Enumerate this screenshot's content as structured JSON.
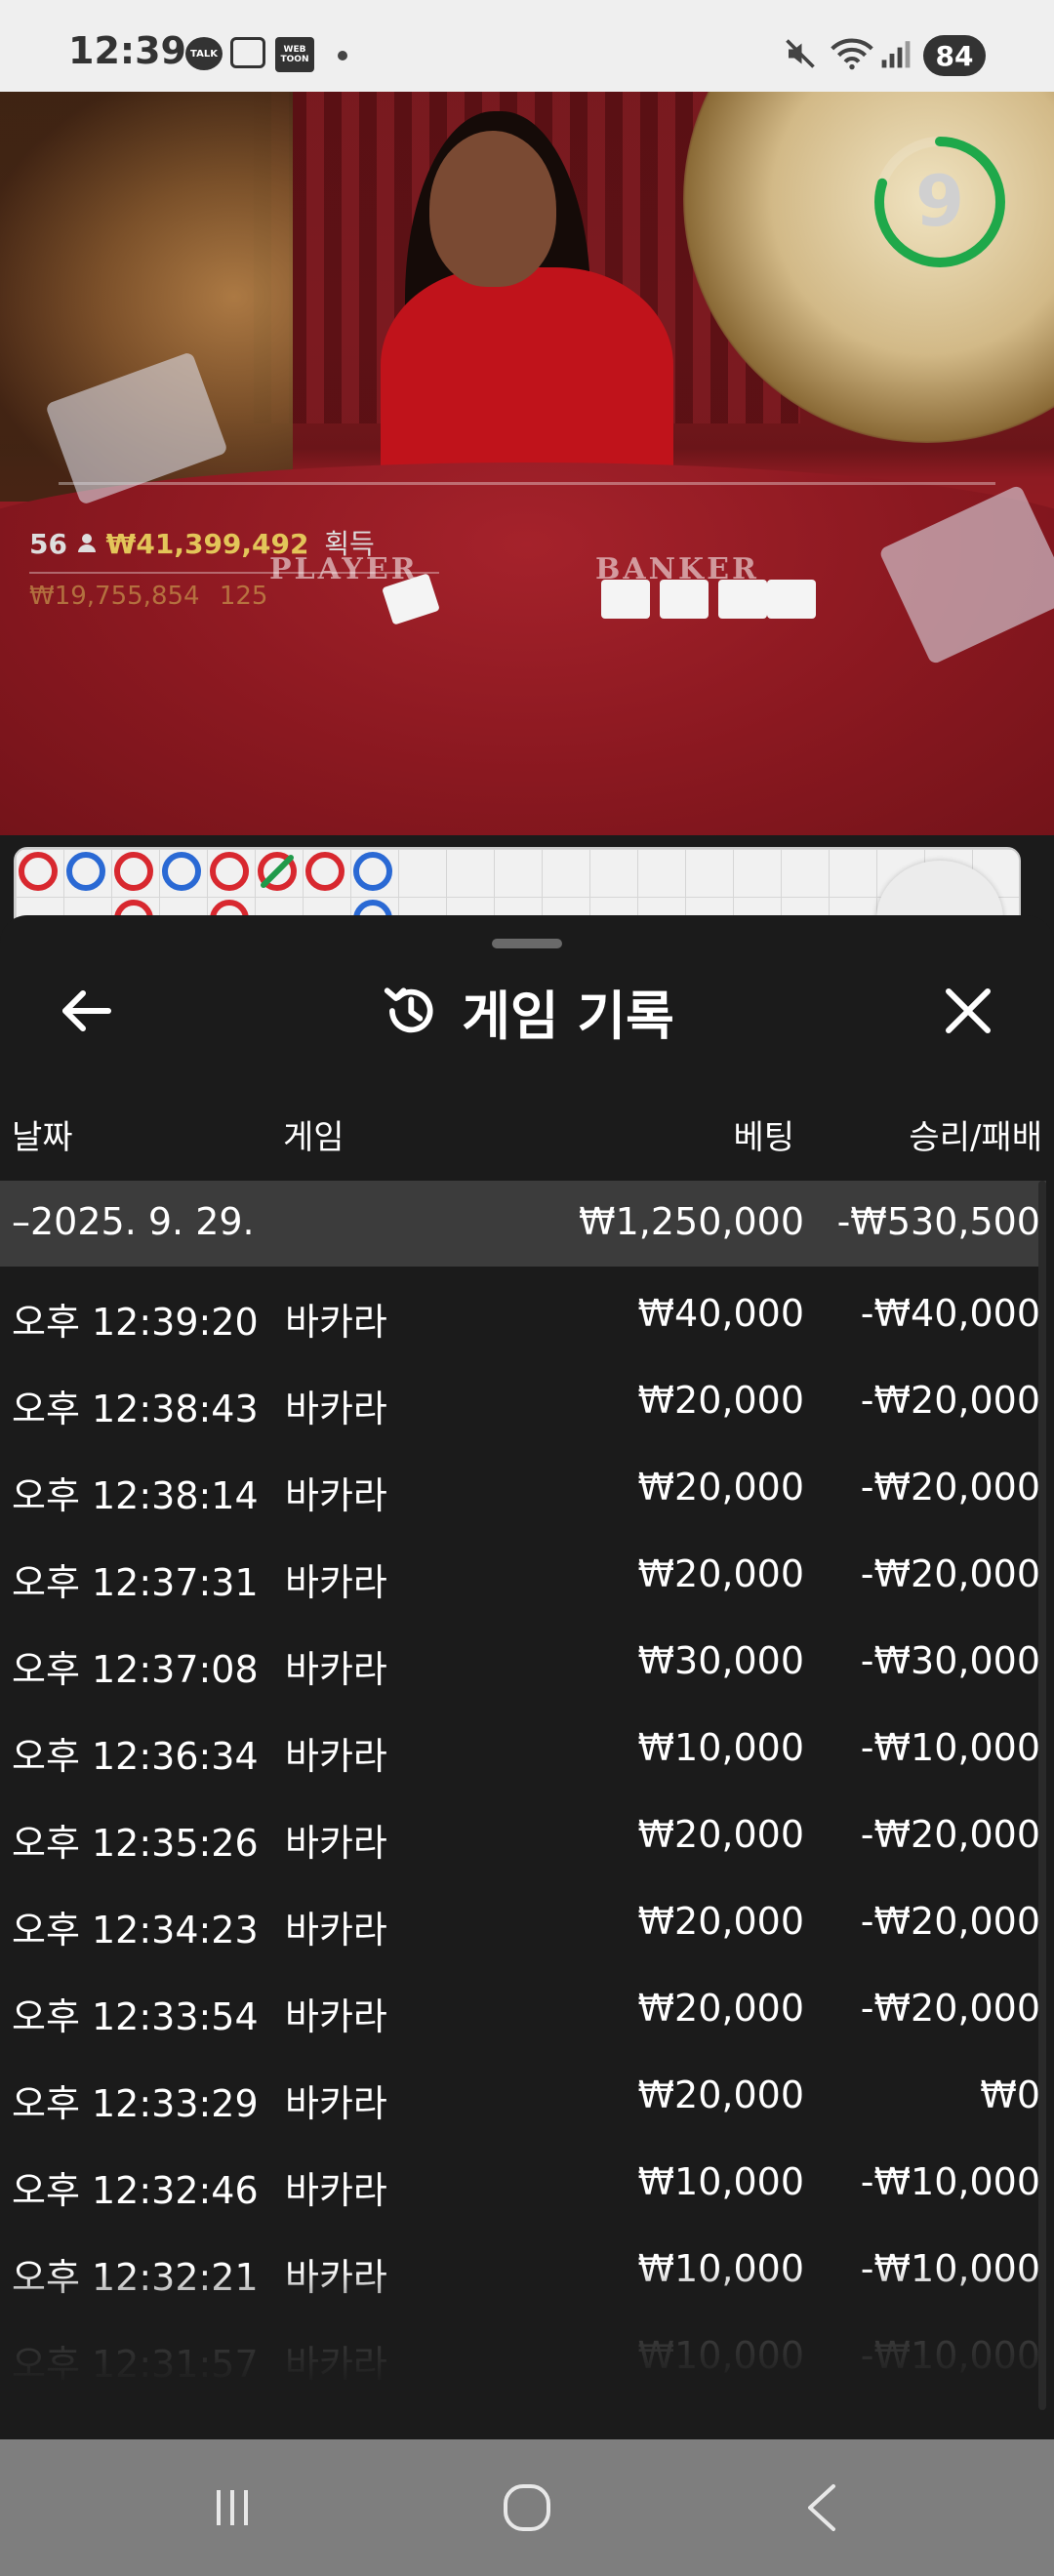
{
  "status_bar": {
    "time": "12:39",
    "talk_badge": "TALK",
    "webtoon_badge": "WEB TOON",
    "battery": "84",
    "icons": [
      "talk-icon",
      "gallery-icon",
      "webtoon-icon",
      "mute-icon",
      "wifi-icon",
      "signal-icon",
      "battery-icon"
    ]
  },
  "game_view": {
    "players_count": "56",
    "win_amount": "₩41,399,492",
    "win_label": "획득",
    "total_bet": "₩19,755,854",
    "bettors": "125",
    "timer_value": "9",
    "timer_progress": 0.8,
    "table_player_label": "PLAYER",
    "table_banker_label": "BANKER",
    "colors": {
      "timer": "#1fa84a",
      "win_amount": "#e3c559",
      "red_bead": "#d8282f",
      "blue_bead": "#2a69d4"
    },
    "bead_road_top": [
      "red",
      "blue",
      "red",
      "blue",
      "red",
      "green-slash",
      "red",
      "blue"
    ],
    "bead_road_second": [
      "",
      "",
      "red",
      "",
      "red",
      "",
      "",
      "blue"
    ]
  },
  "panel": {
    "title": "게임 기록",
    "back_icon": "arrow-left-icon",
    "history_icon": "history-icon",
    "close_icon": "close-icon",
    "columns": {
      "date": "날짜",
      "game": "게임",
      "bet": "베팅",
      "result": "승리/패배"
    },
    "summary": {
      "date": "–2025. 9. 29.",
      "bet": "₩1,250,000",
      "result": "-₩530,500"
    },
    "rows": [
      {
        "time": "오후 12:39:20",
        "game": "바카라",
        "bet": "₩40,000",
        "result": "-₩40,000"
      },
      {
        "time": "오후 12:38:43",
        "game": "바카라",
        "bet": "₩20,000",
        "result": "-₩20,000"
      },
      {
        "time": "오후 12:38:14",
        "game": "바카라",
        "bet": "₩20,000",
        "result": "-₩20,000"
      },
      {
        "time": "오후 12:37:31",
        "game": "바카라",
        "bet": "₩20,000",
        "result": "-₩20,000"
      },
      {
        "time": "오후 12:37:08",
        "game": "바카라",
        "bet": "₩30,000",
        "result": "-₩30,000"
      },
      {
        "time": "오후 12:36:34",
        "game": "바카라",
        "bet": "₩10,000",
        "result": "-₩10,000"
      },
      {
        "time": "오후 12:35:26",
        "game": "바카라",
        "bet": "₩20,000",
        "result": "-₩20,000"
      },
      {
        "time": "오후 12:34:23",
        "game": "바카라",
        "bet": "₩20,000",
        "result": "-₩20,000"
      },
      {
        "time": "오후 12:33:54",
        "game": "바카라",
        "bet": "₩20,000",
        "result": "-₩20,000"
      },
      {
        "time": "오후 12:33:29",
        "game": "바카라",
        "bet": "₩20,000",
        "result": "₩0"
      },
      {
        "time": "오후 12:32:46",
        "game": "바카라",
        "bet": "₩10,000",
        "result": "-₩10,000"
      },
      {
        "time": "오후 12:32:21",
        "game": "바카라",
        "bet": "₩10,000",
        "result": "-₩10,000"
      },
      {
        "time": "오후 12:31:57",
        "game": "바카라",
        "bet": "₩10,000",
        "result": "-₩10,000"
      }
    ]
  },
  "nav_bar": {
    "icons": [
      "recent-apps-icon",
      "home-icon",
      "back-icon"
    ]
  }
}
